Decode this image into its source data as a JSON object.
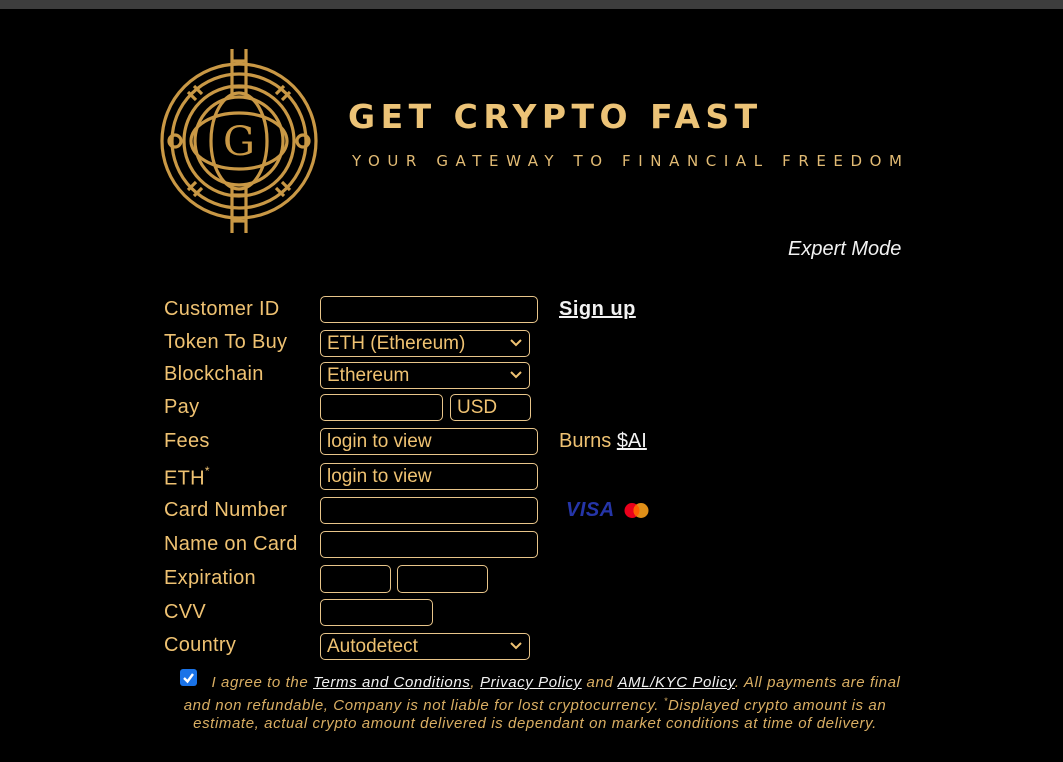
{
  "brand": {
    "title": "GET CRYPTO FAST",
    "tagline": "YOUR GATEWAY TO FINANCIAL FREEDOM",
    "logo_letter": "G",
    "gold": "#ecc377"
  },
  "expert_mode_label": "Expert Mode",
  "form": {
    "customer_id": {
      "label": "Customer ID",
      "value": ""
    },
    "signup_link": "Sign up",
    "token": {
      "label": "Token To Buy",
      "selected": "ETH (Ethereum)"
    },
    "blockchain": {
      "label": "Blockchain",
      "selected": "Ethereum"
    },
    "pay": {
      "label": "Pay",
      "amount": "",
      "currency": "USD"
    },
    "fees": {
      "label": "Fees",
      "value": "login to view",
      "burns_prefix": "Burns",
      "burns_link": "$AI"
    },
    "eth": {
      "label": "ETH",
      "marker": "*",
      "value": "login to view"
    },
    "card_number": {
      "label": "Card Number",
      "value": "",
      "brands": [
        "VISA",
        "Mastercard"
      ]
    },
    "name_on_card": {
      "label": "Name on Card",
      "value": ""
    },
    "expiration": {
      "label": "Expiration",
      "month": "",
      "year": ""
    },
    "cvv": {
      "label": "CVV",
      "value": ""
    },
    "country": {
      "label": "Country",
      "selected": "Autodetect"
    }
  },
  "agreement": {
    "checked": true,
    "text_1": "I agree to the",
    "terms_link": "Terms and Conditions",
    "sep_1": ",",
    "privacy_link": "Privacy Policy",
    "sep_2": "and",
    "aml_link": "AML/KYC Policy",
    "text_2": ". All payments are final and non refundable, Company is not liable for lost cryptocurrency.",
    "marker": "*",
    "text_3": "Displayed crypto amount is an estimate, actual crypto amount delivered is dependant on market conditions at time of delivery."
  }
}
